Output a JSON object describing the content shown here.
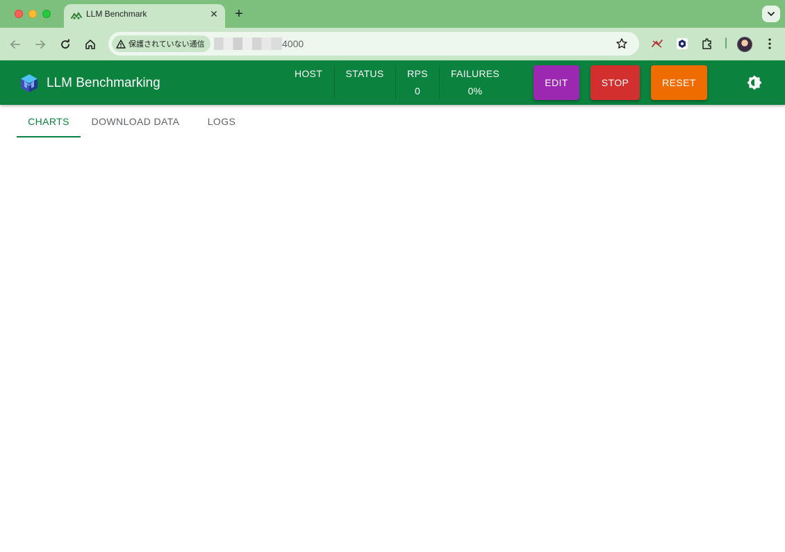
{
  "browser": {
    "tab_title": "LLM Benchmark",
    "tab_close": "✕",
    "new_tab": "+",
    "security_label": "保護されていない通信",
    "url_visible": "4000"
  },
  "app": {
    "title": "LLM Benchmarking",
    "stats": [
      {
        "label": "HOST",
        "value": ""
      },
      {
        "label": "STATUS",
        "value": ""
      },
      {
        "label": "RPS",
        "value": "0"
      },
      {
        "label": "FAILURES",
        "value": "0%"
      }
    ],
    "buttons": {
      "edit": "EDIT",
      "stop": "STOP",
      "reset": "RESET"
    },
    "tabs": [
      "CHARTS",
      "DOWNLOAD DATA",
      "LOGS"
    ]
  },
  "colors": {
    "appbar": "#0b823d",
    "edit": "#9c27b0",
    "stop": "#d32f2f",
    "reset": "#ef6c00",
    "tabstrip": "#7dbf7d",
    "toolbar": "#c9e6c9"
  },
  "icons": {
    "favicon": "locust-icon",
    "logo": "cube-logo-icon",
    "theme": "brightness-icon"
  }
}
